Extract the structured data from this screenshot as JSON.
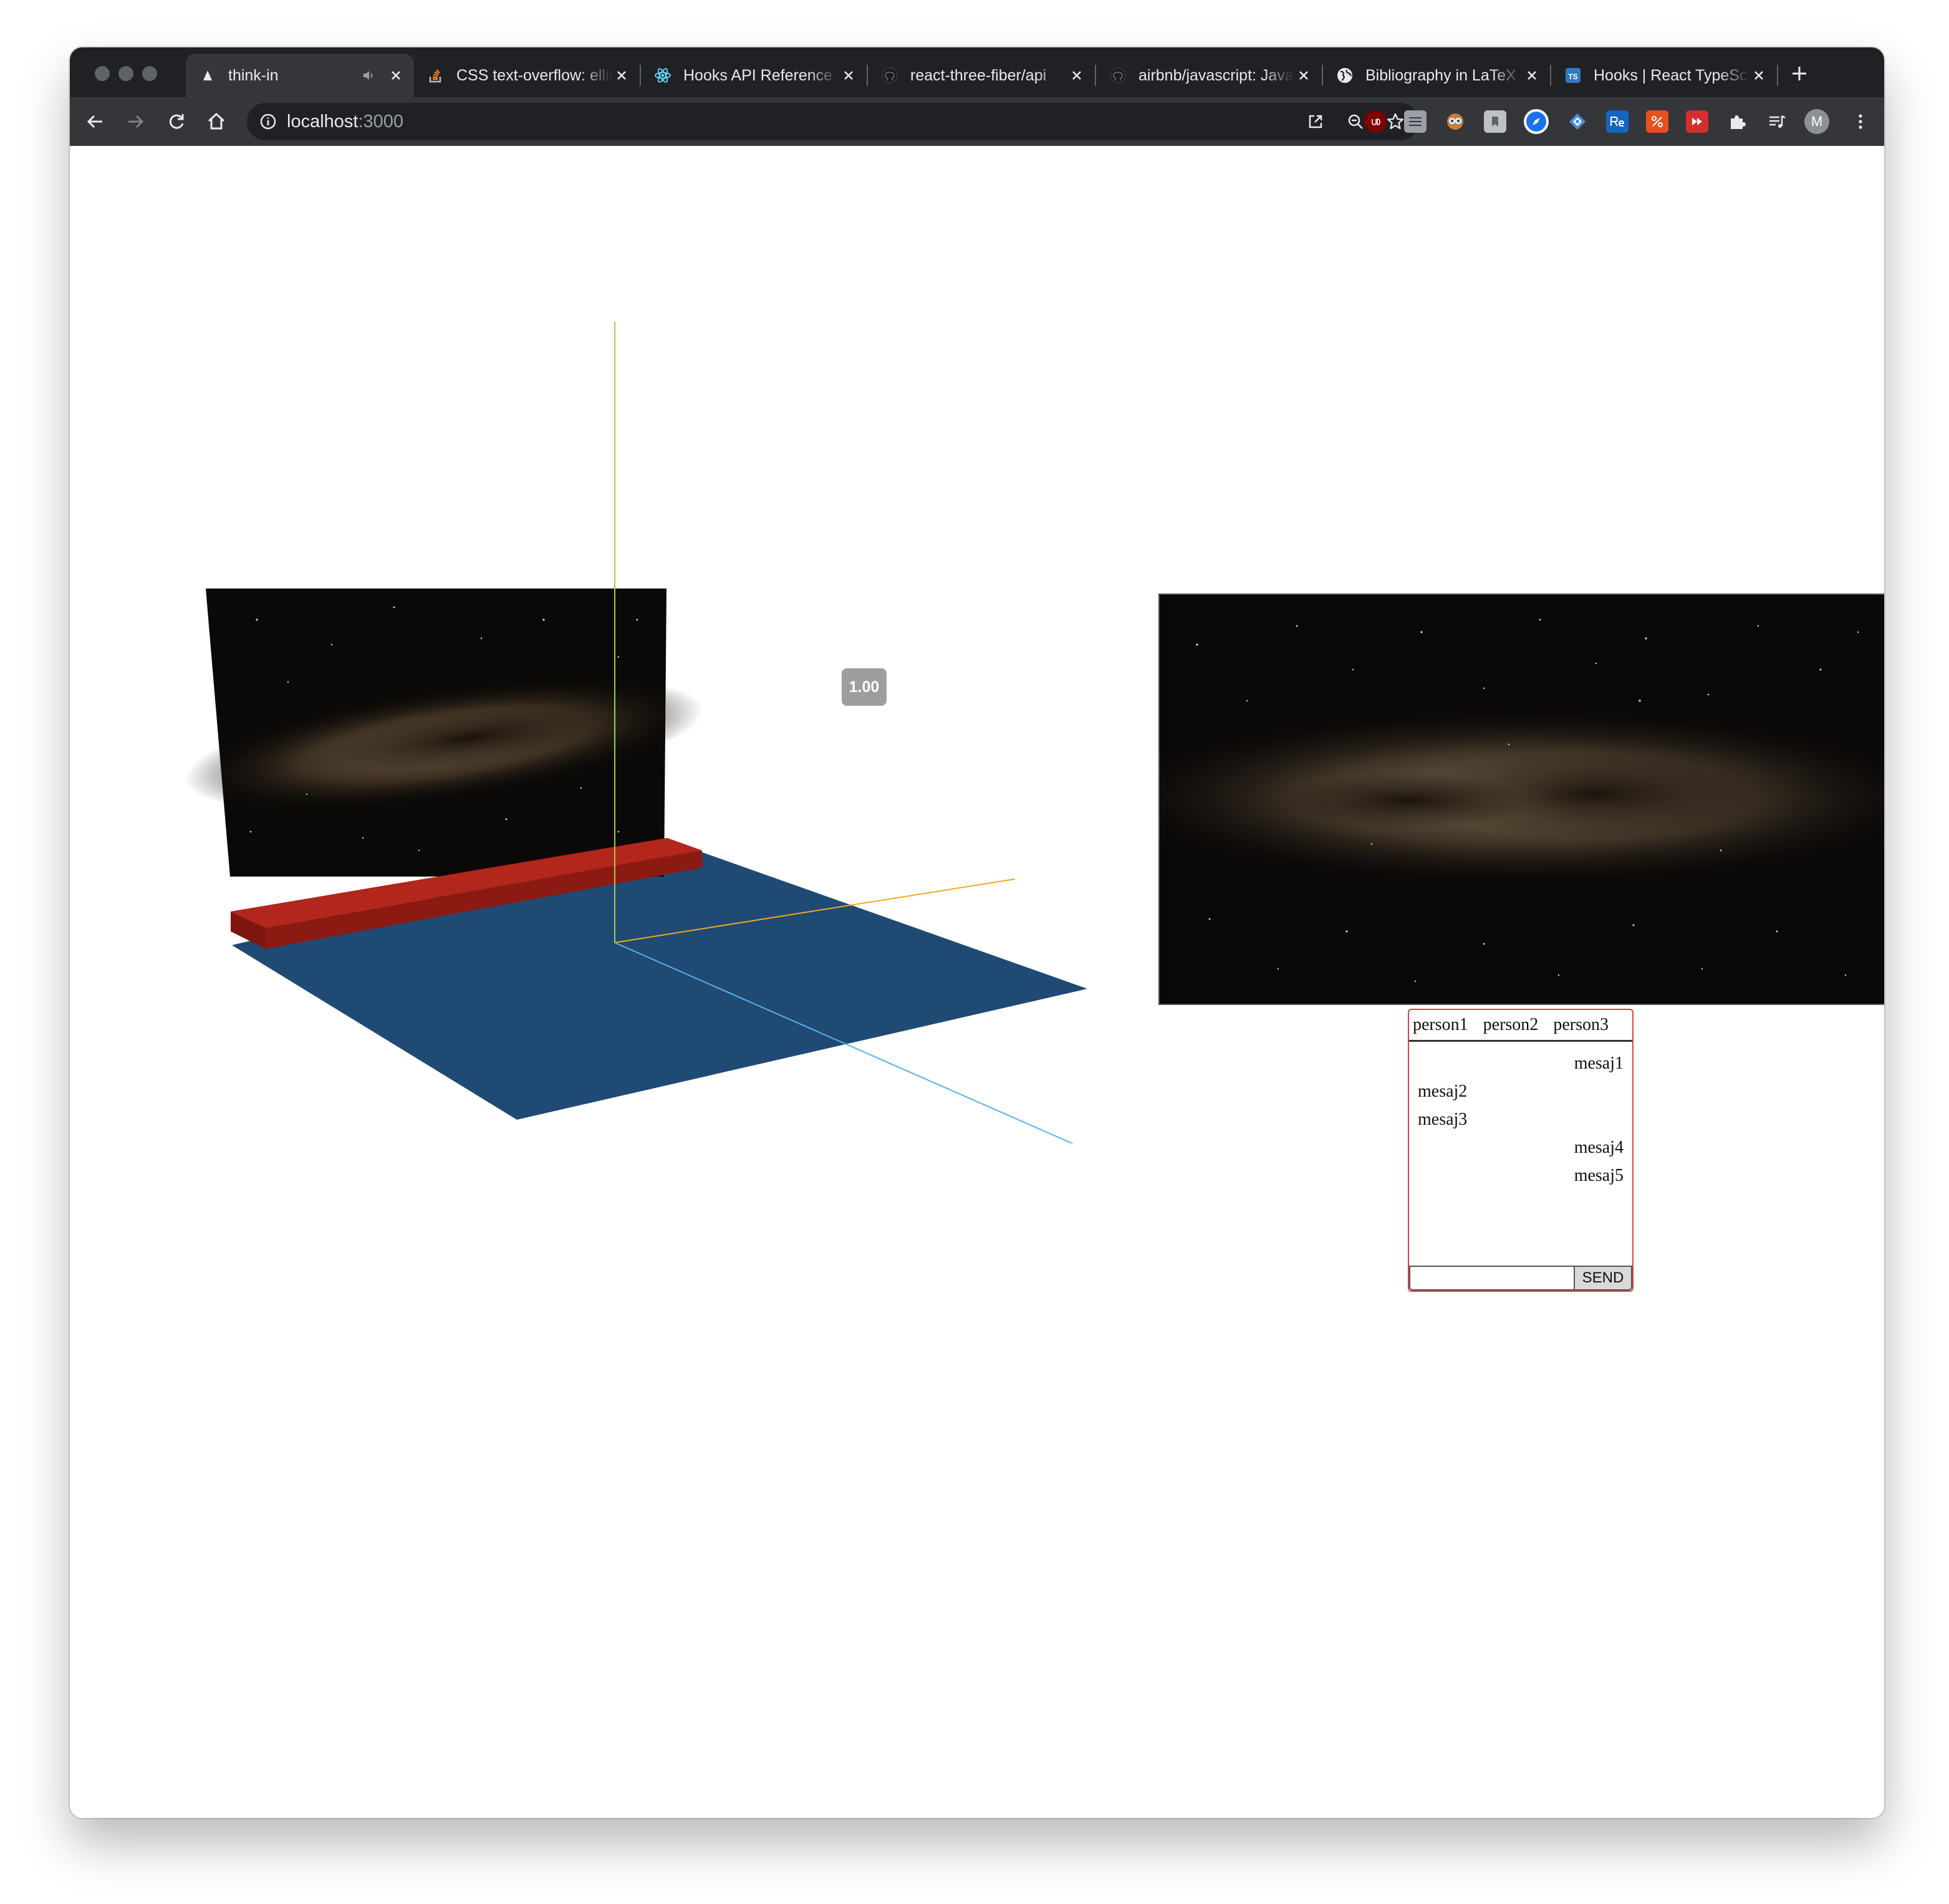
{
  "browser": {
    "tabs": [
      {
        "title": "think-in",
        "icon": "triangle-icon",
        "active": true,
        "audio": true
      },
      {
        "title": "CSS text-overflow: ellipsis",
        "icon": "stackoverflow-icon"
      },
      {
        "title": "Hooks API Reference",
        "icon": "react-icon"
      },
      {
        "title": "react-three-fiber/api",
        "icon": "github-icon"
      },
      {
        "title": "airbnb/javascript: JavaScript",
        "icon": "github-icon"
      },
      {
        "title": "Bibliography in LaTeX",
        "icon": "globe-icon"
      },
      {
        "title": "Hooks | React TypeScript",
        "icon": "typescript-icon"
      }
    ],
    "url_host": "localhost",
    "url_port": ":3000",
    "profile_initial": "M"
  },
  "scene": {
    "zoom_label": "1.00",
    "axis_colors": {
      "x": "#f5a623",
      "y": "#9bd43a",
      "z": "#5ab0f0"
    },
    "floor_color": "#1f4a74",
    "wall_base_color": "#a52018"
  },
  "chat": {
    "participants": [
      "person1",
      "person2",
      "person3"
    ],
    "messages": [
      {
        "text": "mesaj1",
        "align": "right"
      },
      {
        "text": "mesaj2",
        "align": "left"
      },
      {
        "text": "mesaj3",
        "align": "left"
      },
      {
        "text": "mesaj4",
        "align": "right"
      },
      {
        "text": "mesaj5",
        "align": "right"
      }
    ],
    "input_value": "",
    "send_label": "SEND"
  }
}
